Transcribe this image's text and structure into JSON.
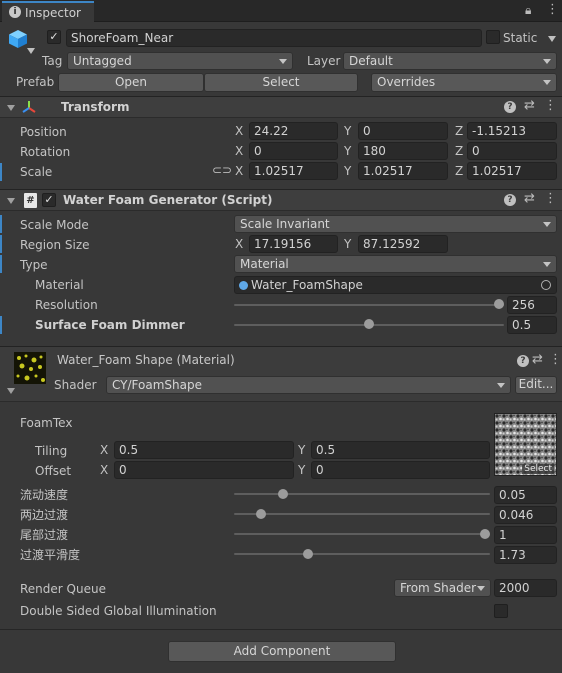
{
  "tab": {
    "title": "Inspector"
  },
  "object": {
    "name": "ShoreFoam_Near",
    "static_label": "Static",
    "tag_label": "Tag",
    "tag_value": "Untagged",
    "layer_label": "Layer",
    "layer_value": "Default",
    "prefab_label": "Prefab",
    "open": "Open",
    "select": "Select",
    "overrides": "Overrides"
  },
  "transform": {
    "title": "Transform",
    "position": {
      "label": "Position",
      "x": "24.22",
      "y": "0",
      "z": "-1.15213"
    },
    "rotation": {
      "label": "Rotation",
      "x": "0",
      "y": "180",
      "z": "0"
    },
    "scale": {
      "label": "Scale",
      "x": "1.02517",
      "y": "1.02517",
      "z": "1.02517"
    }
  },
  "axes": {
    "x": "X",
    "y": "Y",
    "z": "Z"
  },
  "script": {
    "title": "Water Foam Generator (Script)",
    "scale_mode": {
      "label": "Scale Mode",
      "value": "Scale Invariant"
    },
    "region_size": {
      "label": "Region Size",
      "x": "17.19156",
      "y": "87.12592"
    },
    "type": {
      "label": "Type",
      "value": "Material"
    },
    "material": {
      "label": "Material",
      "value": "Water_FoamShape"
    },
    "resolution": {
      "label": "Resolution",
      "value": "256",
      "fraction": 1.0
    },
    "dimmer": {
      "label": "Surface Foam Dimmer",
      "value": "0.5",
      "fraction": 0.5
    }
  },
  "mat": {
    "title": "Water_Foam Shape (Material)",
    "shader_label": "Shader",
    "shader_value": "CY/FoamShape",
    "edit": "Edit...",
    "foamtex": "FoamTex",
    "tiling_label": "Tiling",
    "offset_label": "Offset",
    "tiling": {
      "x": "0.5",
      "y": "0.5"
    },
    "offset": {
      "x": "0",
      "y": "0"
    },
    "select": "Select",
    "props": [
      {
        "label": "流动速度",
        "value": "0.05",
        "fraction": 0.18
      },
      {
        "label": "两边过渡",
        "value": "0.046",
        "fraction": 0.09
      },
      {
        "label": "尾部过渡",
        "value": "1",
        "fraction": 1.0
      },
      {
        "label": "过渡平滑度",
        "value": "1.73",
        "fraction": 0.28
      }
    ],
    "render_queue": {
      "label": "Render Queue",
      "mode": "From Shader",
      "value": "2000"
    },
    "dsgi": {
      "label": "Double Sided Global Illumination"
    }
  },
  "add_component": "Add Component",
  "colors": {
    "accent": "#3d86c6",
    "panel": "#383838",
    "header": "#3e3e3e"
  }
}
